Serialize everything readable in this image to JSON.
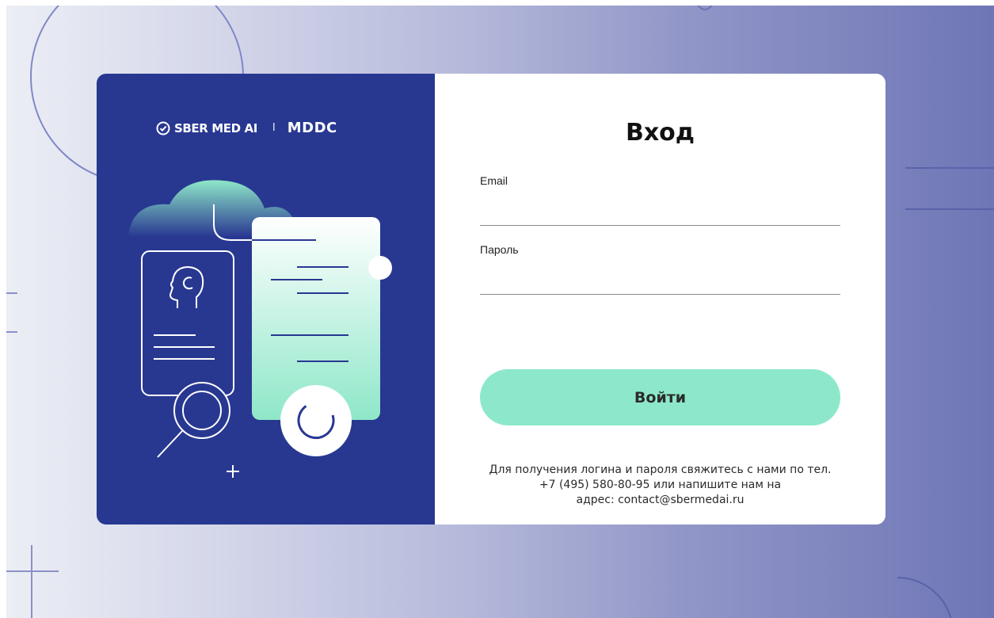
{
  "brand": {
    "name": "SBER MED AI",
    "separator": "I",
    "partner": "MDDC"
  },
  "login": {
    "title": "Вход",
    "email_label": "Email",
    "email_value": "",
    "password_label": "Пароль",
    "password_value": "",
    "submit_label": "Войти"
  },
  "contact": {
    "line1": "Для получения логина и пароля свяжитесь с нами по тел.",
    "line2": "+7 (495) 580-80-95 или напишите нам на",
    "line3": "адрес: contact@sbermedai.ru"
  },
  "colors": {
    "panel": "#283891",
    "accent": "#8de8cb",
    "background_start": "#eceef5",
    "background_end": "#6e76b6"
  },
  "icons": [
    "check-circle-icon",
    "head-profile-icon",
    "magnifier-icon",
    "plus-icon",
    "loading-spinner-icon"
  ]
}
